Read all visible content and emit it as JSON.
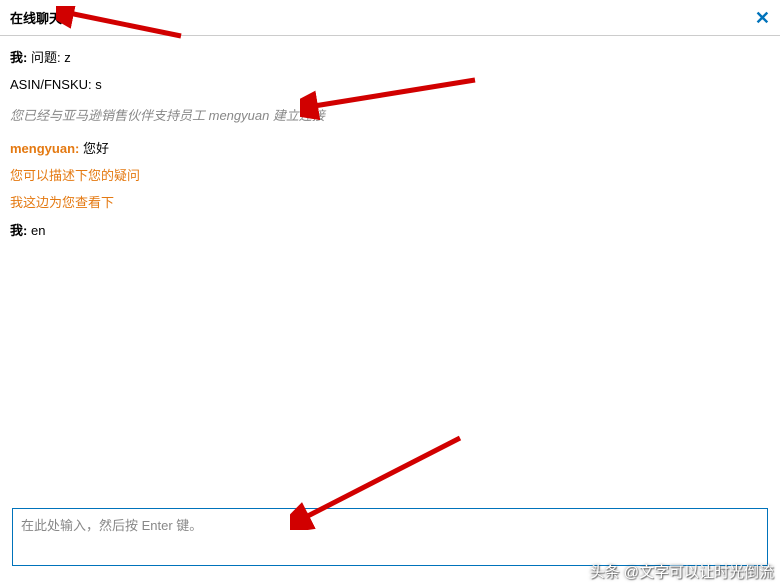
{
  "header": {
    "title": "在线聊天"
  },
  "messages": {
    "me_label": "我:",
    "line1_prefix": "问题:",
    "line1_value": "z",
    "line2_prefix": "ASIN/FNSKU:",
    "line2_value": "s",
    "system": "您已经与亚马逊销售伙伴支持员工 mengyuan 建立连接",
    "agent_name": "mengyuan:",
    "agent_greet": "您好",
    "agent_line1": "您可以描述下您的疑问",
    "agent_line2": "我这边为您查看下",
    "me2_value": "en"
  },
  "input": {
    "placeholder": "在此处输入，然后按 Enter 键。"
  },
  "watermark": "头条 @文字可以让时光倒流"
}
